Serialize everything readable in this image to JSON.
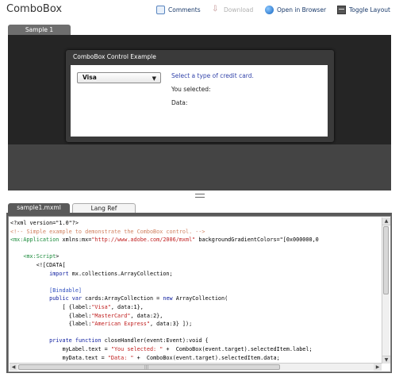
{
  "app": {
    "title": "ComboBox"
  },
  "toolbar": {
    "comments": "Comments",
    "download": "Download",
    "open_browser": "Open in Browser",
    "toggle_layout": "Toggle Layout"
  },
  "sample": {
    "tab_label": "Sample 1",
    "panel_title": "ComboBox Control Example",
    "combo_value": "Visa",
    "select_prompt": "Select a type of credit card.",
    "selected_label": "You selected:",
    "data_label": "Data:"
  },
  "code_tabs": {
    "active": "sample1.mxml",
    "inactive": "Lang Ref"
  },
  "code": {
    "lines": [
      "<?xml version=\"1.0\"?>",
      "<!-- Simple example to demonstrate the ComboBox control. -->",
      "<mx:Application xmlns:mx=\"http://www.adobe.com/2006/mxml\" backgroundGradientColors=\"[0x000000,0",
      "",
      "    <mx:Script>",
      "        <![CDATA[",
      "            import mx.collections.ArrayCollection;",
      "",
      "            [Bindable]",
      "            public var cards:ArrayCollection = new ArrayCollection(",
      "                [ {label:\"Visa\", data:1},",
      "                  {label:\"MasterCard\", data:2},",
      "                  {label:\"American Express\", data:3} ]);",
      "",
      "            private function closeHandler(event:Event):void {",
      "                myLabel.text = \"You selected: \" +  ComboBox(event.target).selectedItem.label;",
      "                myData.text = \"Data: \" +  ComboBox(event.target).selectedItem.data;",
      "            }"
    ]
  },
  "colors": {
    "sample_bg": "#252525",
    "panel_bg": "#3a3a3a",
    "comment": "#d08060",
    "tag": "#1a8a3a",
    "string": "#c02020",
    "keyword": "#1020a0"
  }
}
